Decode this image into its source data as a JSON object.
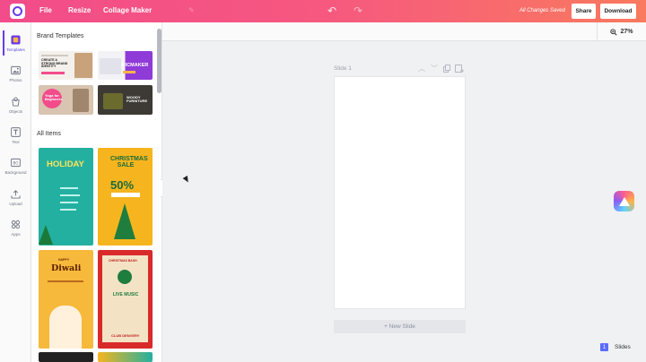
{
  "topbar": {
    "menu": [
      "File",
      "Resize",
      "Collage Maker"
    ],
    "status": "All Changes Saved",
    "share_label": "Share",
    "download_label": "Download"
  },
  "rail": {
    "items": [
      {
        "label": "Templates",
        "icon": "templates-icon"
      },
      {
        "label": "Photos",
        "icon": "photos-icon"
      },
      {
        "label": "Objects",
        "icon": "objects-icon"
      },
      {
        "label": "Text",
        "icon": "text-icon"
      },
      {
        "label": "Background",
        "icon": "background-icon"
      },
      {
        "label": "Upload",
        "icon": "upload-icon"
      },
      {
        "label": "Apps",
        "icon": "apps-icon"
      }
    ],
    "active": "Templates"
  },
  "panel": {
    "brand_title": "Brand Templates",
    "all_items_title": "All Items",
    "brand_templates": [
      {
        "text": "CREATE A STRONG BRAND IDENTITY"
      },
      {
        "text": "PICMAKER"
      },
      {
        "text": "Yoga for Beginners"
      },
      {
        "text": "WOODY FURNITURE"
      }
    ],
    "templates": [
      {
        "title": "HOLIDAY"
      },
      {
        "title": "CHRISTMAS SALE",
        "subtitle": "50%"
      },
      {
        "title": "Diwali",
        "kicker": "HAPPY"
      },
      {
        "title": "LIVE MUSIC",
        "kicker": "CHRISTMAS BASH",
        "footer": "CLUB DENVERY"
      }
    ]
  },
  "canvas": {
    "zoom": "27%",
    "slide_label": "Slide 1",
    "new_slide_label": "+ New Slide",
    "slides_count": "1",
    "slides_label": "Slides"
  },
  "colors": {
    "accent": "#6a3ce8",
    "topbar_start": "#f24c8a",
    "topbar_end": "#f97a5e"
  }
}
